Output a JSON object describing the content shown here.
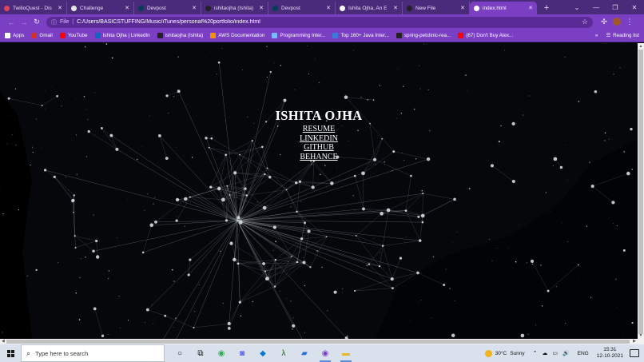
{
  "browser": {
    "tabs": [
      {
        "title": "TwilioQuest - Dis",
        "icon": "twilioquest-icon",
        "color": "#e0425a",
        "active": false
      },
      {
        "title": "Challenge",
        "icon": "challenge-icon",
        "color": "#e6e6e6",
        "active": false
      },
      {
        "title": "Devpost",
        "icon": "devpost-icon",
        "color": "#003e54",
        "active": false
      },
      {
        "title": "ishitaojha (Ishita)",
        "icon": "github-icon",
        "color": "#222",
        "active": false
      },
      {
        "title": "Devpost",
        "icon": "devpost-icon",
        "color": "#003e54",
        "active": false
      },
      {
        "title": "Ishita Ojha, An E",
        "icon": "globe-icon",
        "color": "#ffffff",
        "active": false
      },
      {
        "title": "New File",
        "icon": "github-icon",
        "color": "#222",
        "active": false
      },
      {
        "title": "index.html",
        "icon": "globe-icon",
        "color": "#ffffff",
        "active": true
      }
    ],
    "new_tab_label": "+",
    "window_controls": {
      "tab_search": "⌄",
      "minimize": "—",
      "restore": "❐",
      "close": "✕"
    },
    "address": {
      "scheme_label": "File",
      "url": "C:/Users/BASICSTUFFING/Music/iTunes/personal%20portfolio/index.html"
    },
    "bookmarks": [
      {
        "label": "Apps",
        "icon": "apps-grid-icon",
        "color": "#ffffff"
      },
      {
        "label": "Gmail",
        "icon": "gmail-icon",
        "color": "#d93025"
      },
      {
        "label": "YouTube",
        "icon": "youtube-icon",
        "color": "#ff0000"
      },
      {
        "label": "Ishita Ojha | LinkedIn",
        "icon": "linkedin-icon",
        "color": "#0a66c2"
      },
      {
        "label": "ishitaojha (Ishita)",
        "icon": "github-icon",
        "color": "#222222"
      },
      {
        "label": "AWS Documentation",
        "icon": "aws-icon",
        "color": "#f29100"
      },
      {
        "label": "Programming Inter...",
        "icon": "programming-icon",
        "color": "#7ab8ff"
      },
      {
        "label": "Top 160+ Java Inter...",
        "icon": "java-icon",
        "color": "#3c7bd8"
      },
      {
        "label": "spring-petclinic-rea...",
        "icon": "github-icon",
        "color": "#222222"
      },
      {
        "label": "(67) Don't Buy Alex...",
        "icon": "youtube-icon",
        "color": "#ff0000"
      }
    ],
    "bookmarks_more": "»",
    "reading_list": "Reading list"
  },
  "page": {
    "name": "ISHITA OJHA",
    "links": [
      "RESUME",
      "LINKEDIN",
      "GITHUB",
      "BEHANCE"
    ]
  },
  "taskbar": {
    "search_placeholder": "Type here to search",
    "apps": [
      {
        "name": "cortana-icon",
        "glyph": "○",
        "color": "#111"
      },
      {
        "name": "task-view-icon",
        "glyph": "⧉",
        "color": "#111"
      },
      {
        "name": "chrome-icon",
        "glyph": "◉",
        "color": "#2da94f"
      },
      {
        "name": "discord-icon",
        "glyph": "◙",
        "color": "#5865f2"
      },
      {
        "name": "vscode-icon",
        "glyph": "◆",
        "color": "#0078d4"
      },
      {
        "name": "lambda-app-icon",
        "glyph": "λ",
        "color": "#1b5e20"
      },
      {
        "name": "store-icon",
        "glyph": "▰",
        "color": "#2a6fd6"
      },
      {
        "name": "chrome-active-icon",
        "glyph": "◉",
        "color": "#7b3fc4"
      },
      {
        "name": "file-explorer-icon",
        "glyph": "▬",
        "color": "#e8b730"
      }
    ],
    "weather": {
      "temp": "30°C",
      "condition": "Sunny"
    },
    "system_tray": "⌃ ☁ ▭ 🔊",
    "language": "ENG",
    "time": "15:31",
    "date": "12-10-2021"
  }
}
